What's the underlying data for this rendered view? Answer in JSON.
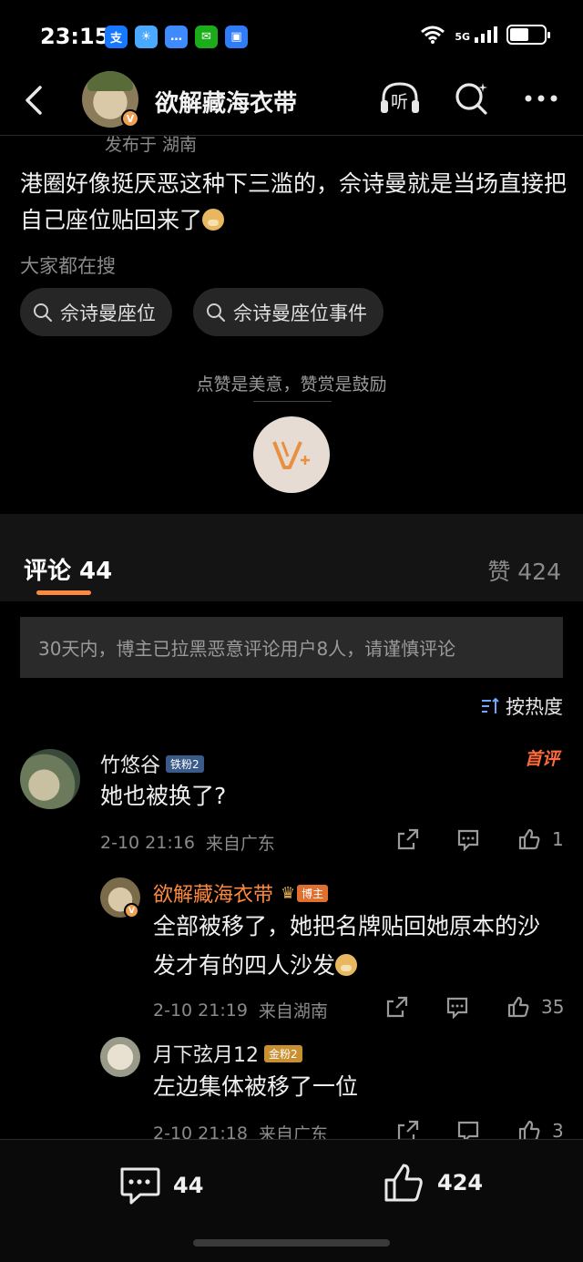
{
  "status_bar": {
    "time": "23:15",
    "app_icons": [
      {
        "name": "alipay-icon",
        "glyph": "支",
        "color": "#1677ff"
      },
      {
        "name": "weather-icon",
        "glyph": "☀",
        "color": "#4aa8ff"
      },
      {
        "name": "messages-icon",
        "glyph": "…",
        "color": "#3d8bff"
      },
      {
        "name": "wechat-icon",
        "glyph": "✉",
        "color": "#1aad19"
      },
      {
        "name": "app-icon",
        "glyph": "▣",
        "color": "#2f7cf6"
      }
    ],
    "network": "5G"
  },
  "header": {
    "title": "欲解藏海衣带",
    "listen_label": "听"
  },
  "post": {
    "meta": "发布于 湖南",
    "text": "港圈好像挺厌恶这种下三滥的，佘诗曼就是当场直接把自己座位贴回来了",
    "search_label": "大家都在搜",
    "search_chips": [
      "佘诗曼座位",
      "佘诗曼座位事件"
    ],
    "reward_text": "点赞是美意，赞赏是鼓励"
  },
  "tabs": {
    "comments_label": "评论 44",
    "likes_label": "赞 424"
  },
  "notice": "30天内，博主已拉黑恶意评论用户8人，请谨慎评论",
  "sort_label": "按热度",
  "comments": [
    {
      "name": "竹悠谷",
      "badge": "铁粉2",
      "text": "她也被换了?",
      "time": "2-10 21:16",
      "location": "来自广东",
      "likes": "1",
      "tag": "首评"
    },
    {
      "name": "欲解藏海衣带",
      "badge": "博主",
      "text": "全部被移了，她把名牌贴回她原本的沙发才有的四人沙发",
      "time": "2-10 21:19",
      "location": "来自湖南",
      "likes": "35"
    },
    {
      "name": "月下弦月12",
      "badge": "金粉2",
      "text": "左边集体被移了一位",
      "time": "2-10 21:18",
      "location": "来自广东",
      "likes": "3"
    }
  ],
  "bottom_bar": {
    "comment_count": "44",
    "like_count": "424"
  },
  "colors": {
    "accent": "#ff8a3d",
    "background": "#000000"
  }
}
